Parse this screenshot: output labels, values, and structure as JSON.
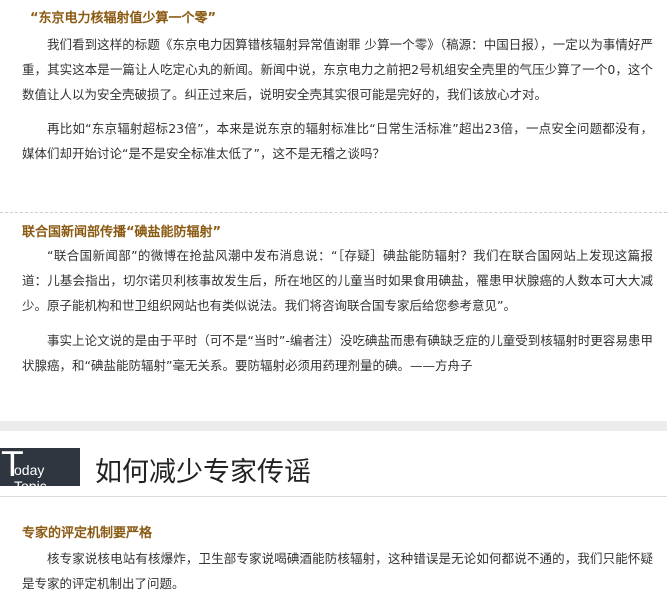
{
  "section1": {
    "heading": "“东京电力核辐射值少算一个零”",
    "paragraphs": [
      "我们看到这样的标题《东京电力因算错核辐射异常值谢罪 少算一个零》（稿源：中国日报），一定以为事情好严重，其实这本是一篇让人吃定心丸的新闻。新闻中说，东京电力之前把2号机组安全壳里的气压少算了一个0，这个数值让人以为安全壳破损了。纠正过来后，说明安全壳其实很可能是完好的，我们该放心才对。",
      "再比如“东京辐射超标23倍”，本来是说东京的辐射标准比“日常生活标准”超出23倍，一点安全问题都没有，媒体们却开始讨论“是不是安全标准太低了”，这不是无稽之谈吗？"
    ]
  },
  "section2": {
    "heading": "联合国新闻部传播“碘盐能防辐射”",
    "paragraphs": [
      "“联合国新闻部”的微博在抢盐风潮中发布消息说：“［存疑］碘盐能防辐射？我们在联合国网站上发现这篇报道：儿基会指出，切尔诺贝利核事故发生后，所在地区的儿童当时如果食用碘盐，罹患甲状腺癌的人数本可大大减少。原子能机构和世卫组织网站也有类似说法。我们将咨询联合国专家后给您参考意见”。",
      "事实上论文说的是由于平时（可不是“当时”-编者注）没吃碘盐而患有碘缺乏症的儿童受到核辐射时更容易患甲状腺癌，和“碘盐能防辐射”毫无关系。要防辐射必须用药理剂量的碘。——方舟子"
    ]
  },
  "topic": {
    "logo_big": "T",
    "logo_small": "oday Topic",
    "title": "如何减少专家传谣"
  },
  "section3": {
    "heading": "专家的评定机制要严格",
    "paragraphs": [
      "核专家说核电站有核爆炸，卫生部专家说喝碘酒能防核辐射，这种错误是无论如何都说不通的，我们只能怀疑是专家的评定机制出了问题。"
    ]
  },
  "colors": {
    "heading": "#8a5a12",
    "logo_bg": "#2f3640",
    "text": "#333333"
  }
}
